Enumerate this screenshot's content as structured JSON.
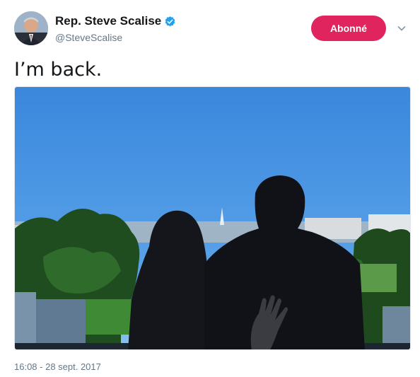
{
  "author": {
    "display_name": "Rep. Steve Scalise",
    "handle": "@SteveScalise",
    "verified_icon": "verified-badge-icon",
    "avatar_icon": "avatar-photo"
  },
  "actions": {
    "follow_label": "Abonné",
    "more_icon": "chevron-down-icon"
  },
  "tweet": {
    "text": "I’m back.",
    "timestamp": "16:08 - 28 sept. 2017"
  },
  "colors": {
    "follow_button": "#e0245e",
    "verified": "#1da1f2",
    "secondary_text": "#657786",
    "sky": "#3f8fe0"
  }
}
